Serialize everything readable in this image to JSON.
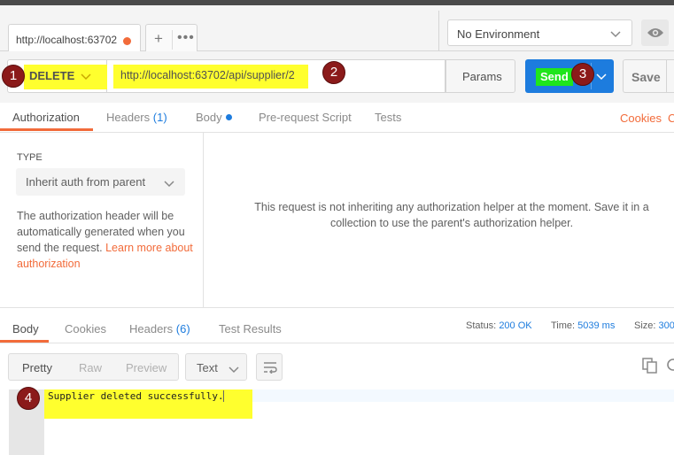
{
  "tab": {
    "label": "http://localhost:63702",
    "unsaved_color": "#f26b3a"
  },
  "tab_actions": {
    "add": "+",
    "more": "•••"
  },
  "environment": {
    "selected": "No Environment"
  },
  "request": {
    "method": "DELETE",
    "url": "http://localhost:63702/api/supplier/2",
    "params_label": "Params",
    "send_label": "Send",
    "save_label": "Save"
  },
  "request_tabs": [
    {
      "label": "Authorization"
    },
    {
      "label": "Headers",
      "count": "(1)"
    },
    {
      "label": "Body"
    },
    {
      "label": "Pre-request Script"
    },
    {
      "label": "Tests"
    }
  ],
  "request_links": {
    "cookies": "Cookies",
    "code": "C"
  },
  "authorization": {
    "type_label": "TYPE",
    "type_value": "Inherit auth from parent",
    "description": "The authorization header will be automatically generated when you send the request.",
    "learn_more": "Learn more about authorization",
    "message": "This request is not inheriting any authorization helper at the moment. Save it in a collection to use the parent's authorization helper."
  },
  "response_tabs": [
    {
      "label": "Body"
    },
    {
      "label": "Cookies"
    },
    {
      "label": "Headers",
      "count": "(6)"
    },
    {
      "label": "Test Results"
    }
  ],
  "response_meta": {
    "status_label": "Status:",
    "status_value": "200 OK",
    "time_label": "Time:",
    "time_value": "5039 ms",
    "size_label": "Size:",
    "size_value": "300"
  },
  "response_toolbar": {
    "formats": [
      "Pretty",
      "Raw",
      "Preview"
    ],
    "active_format": "Pretty",
    "type_select": "Text"
  },
  "response_body": {
    "text": "Supplier deleted successfully."
  },
  "markers": [
    "1",
    "2",
    "3",
    "4"
  ],
  "colors": {
    "accent": "#f26b3a",
    "primary": "#1d7cde",
    "highlight": "#ffff2e",
    "send_highlight": "#1fe51c",
    "marker": "#8b1a1a"
  }
}
